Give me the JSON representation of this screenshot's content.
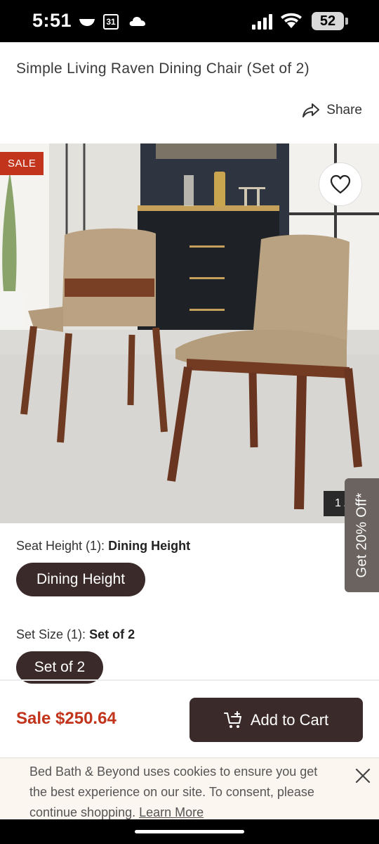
{
  "status_bar": {
    "time": "5:51",
    "calendar_day": "31",
    "battery": "52"
  },
  "product": {
    "title": "Simple Living Raven Dining Chair (Set of 2)",
    "share_label": "Share",
    "sale_badge": "SALE",
    "image_counter": "1 /"
  },
  "options": {
    "seat_height": {
      "label": "Seat Height (1):",
      "selected": "Dining Height",
      "choices": [
        "Dining Height"
      ]
    },
    "set_size": {
      "label": "Set Size (1):",
      "selected": "Set of 2",
      "choices": [
        "Set of 2"
      ]
    }
  },
  "promo_tab": "Get 20% Off*",
  "purchase": {
    "price": "Sale $250.64",
    "add_to_cart": "Add to Cart"
  },
  "cookie_banner": {
    "text": "Bed Bath & Beyond uses cookies to ensure you get the best experience on our site. To consent, please continue shopping.",
    "link": "Learn More"
  },
  "colors": {
    "brand_dark": "#3b2a2a",
    "sale_red": "#c2341b",
    "promo_gray": "#6b6360"
  },
  "icons": [
    "bowl-icon",
    "calendar-icon",
    "cloud-icon",
    "signal-icon",
    "wifi-icon",
    "battery-icon",
    "share-icon",
    "heart-icon",
    "cart-plus-icon",
    "close-icon"
  ]
}
